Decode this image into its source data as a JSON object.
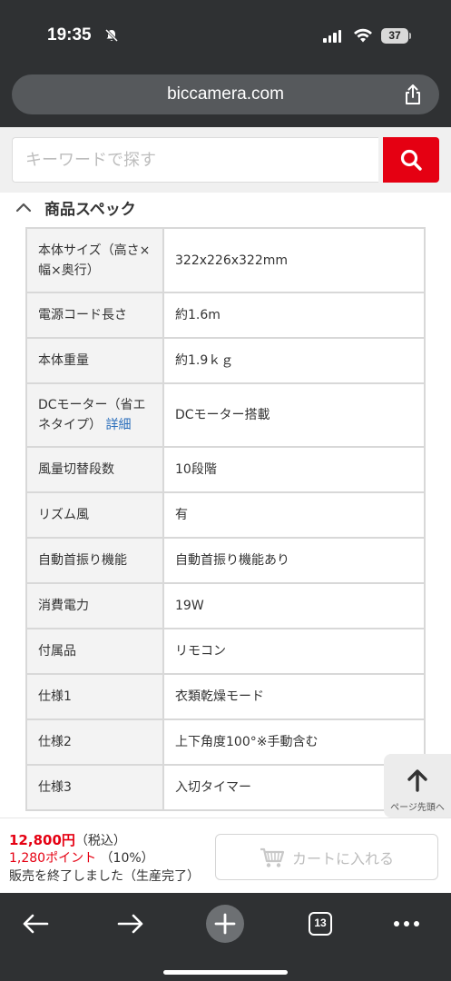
{
  "status_bar": {
    "time": "19:35",
    "battery": "37"
  },
  "browser": {
    "url": "biccamera.com"
  },
  "search": {
    "placeholder": "キーワードで探す"
  },
  "specs": {
    "section_title": "商品スペック",
    "rows": [
      {
        "label": "本体サイズ（高さ×幅×奥行）",
        "value": "322x226x322mm"
      },
      {
        "label": "電源コード長さ",
        "value": "約1.6m"
      },
      {
        "label": "本体重量",
        "value": "約1.9ｋｇ"
      },
      {
        "label": "DCモーター（省エネタイプ）",
        "link": "詳細",
        "value": "DCモーター搭載"
      },
      {
        "label": "風量切替段数",
        "value": "10段階"
      },
      {
        "label": "リズム風",
        "value": "有"
      },
      {
        "label": "自動首振り機能",
        "value": "自動首振り機能あり"
      },
      {
        "label": "消費電力",
        "value": "19W"
      },
      {
        "label": "付属品",
        "value": "リモコン"
      },
      {
        "label": "仕様1",
        "value": "衣類乾燥モード"
      },
      {
        "label": "仕様2",
        "value": "上下角度100°※手動含む"
      },
      {
        "label": "仕様3",
        "value": "入切タイマー"
      }
    ]
  },
  "page_top": {
    "label": "ページ先頭へ"
  },
  "purchase": {
    "price": "12,800円",
    "tax_note": "（税込）",
    "points": "1,280ポイント",
    "points_rate": "（10%）",
    "status": "販売を終了しました（生産完了）",
    "cart_label": "カートに入れる"
  },
  "toolbar": {
    "tab_count": "13"
  },
  "colors": {
    "brand_red": "#e50012",
    "chrome_dark": "#2f3133",
    "link_blue": "#2a6ebb"
  }
}
